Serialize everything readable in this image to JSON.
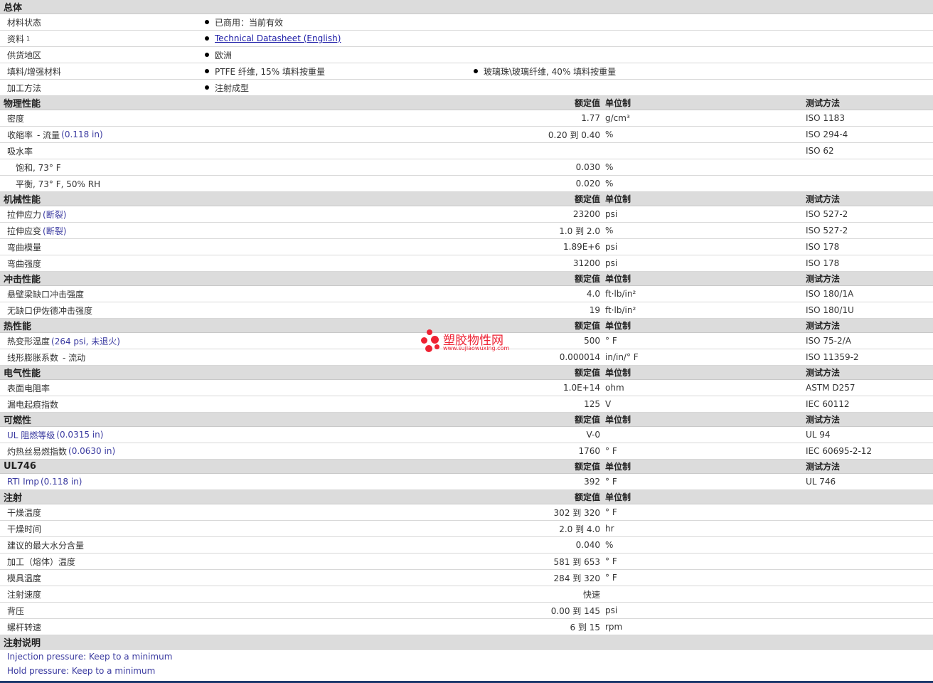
{
  "sections": [
    {
      "title": "总体",
      "kind": "general",
      "rows": [
        {
          "label": "材料状态",
          "values": [
            "已商用：当前有效"
          ]
        },
        {
          "label": "资料",
          "sup": "1",
          "values": [
            "Technical Datasheet (English)"
          ],
          "link": true
        },
        {
          "label": "供货地区",
          "values": [
            "欧洲"
          ]
        },
        {
          "label": "填料/增强材料",
          "values": [
            "PTFE 纤维, 15% 填料按重量",
            "玻璃珠\\玻璃纤维, 40% 填料按重量"
          ]
        },
        {
          "label": "加工方法",
          "values": [
            "注射成型"
          ]
        }
      ]
    },
    {
      "title": "物理性能",
      "col_value": "额定值",
      "col_unit": "单位制",
      "col_method": "测试方法",
      "rows": [
        {
          "label": "密度",
          "value": "1.77",
          "unit": "g/cm³",
          "method": "ISO 1183"
        },
        {
          "label": "收缩率",
          "suffix": "- 流量",
          "cond": "(0.118 in)",
          "value": "0.20 到 0.40",
          "unit": "%",
          "method": "ISO 294-4"
        },
        {
          "label": "吸水率",
          "value": "",
          "unit": "",
          "method": "ISO 62"
        },
        {
          "label": "饱和, 73° F",
          "sub": true,
          "value": "0.030",
          "unit": "%",
          "method": ""
        },
        {
          "label": "平衡, 73° F, 50% RH",
          "sub": true,
          "value": "0.020",
          "unit": "%",
          "method": ""
        }
      ]
    },
    {
      "title": "机械性能",
      "col_value": "额定值",
      "col_unit": "单位制",
      "col_method": "测试方法",
      "rows": [
        {
          "label": "拉伸应力",
          "cond": "(断裂)",
          "value": "23200",
          "unit": "psi",
          "method": "ISO 527-2"
        },
        {
          "label": "拉伸应变",
          "cond": "(断裂)",
          "value": "1.0 到 2.0",
          "unit": "%",
          "method": "ISO 527-2"
        },
        {
          "label": "弯曲模量",
          "value": "1.89E+6",
          "unit": "psi",
          "method": "ISO 178"
        },
        {
          "label": "弯曲强度",
          "value": "31200",
          "unit": "psi",
          "method": "ISO 178"
        }
      ]
    },
    {
      "title": "冲击性能",
      "col_value": "额定值",
      "col_unit": "单位制",
      "col_method": "测试方法",
      "rows": [
        {
          "label": "悬壁梁缺口冲击强度",
          "value": "4.0",
          "unit": "ft·lb/in²",
          "method": "ISO 180/1A"
        },
        {
          "label": "无缺口伊佐德冲击强度",
          "value": "19",
          "unit": "ft·lb/in²",
          "method": "ISO 180/1U"
        }
      ]
    },
    {
      "title": "热性能",
      "col_value": "额定值",
      "col_unit": "单位制",
      "col_method": "测试方法",
      "rows": [
        {
          "label": "热变形温度",
          "cond": "(264 psi, 未退火)",
          "value": "500",
          "unit": "° F",
          "method": "ISO 75-2/A"
        },
        {
          "label": "线形膨胀系数",
          "suffix": "- 流动",
          "value": "0.000014",
          "unit": "in/in/° F",
          "method": "ISO 11359-2"
        }
      ]
    },
    {
      "title": "电气性能",
      "col_value": "额定值",
      "col_unit": "单位制",
      "col_method": "测试方法",
      "rows": [
        {
          "label": "表面电阻率",
          "value": "1.0E+14",
          "unit": "ohm",
          "method": "ASTM D257"
        },
        {
          "label": "漏电起痕指数",
          "value": "125",
          "unit": "V",
          "method": "IEC 60112"
        }
      ]
    },
    {
      "title": "可燃性",
      "col_value": "额定值",
      "col_unit": "单位制",
      "col_method": "测试方法",
      "rows": [
        {
          "label": "UL 阻燃等级",
          "blue_label": true,
          "cond": "(0.0315 in)",
          "value": "V-0",
          "unit": "",
          "method": "UL 94"
        },
        {
          "label": "灼热丝易燃指数",
          "cond": "(0.0630 in)",
          "value": "1760",
          "unit": "° F",
          "method": "IEC 60695-2-12"
        }
      ]
    },
    {
      "title": "UL746",
      "col_value": "额定值",
      "col_unit": "单位制",
      "col_method": "测试方法",
      "rows": [
        {
          "label": "RTI Imp",
          "blue_label": true,
          "cond": "(0.118 in)",
          "value": "392",
          "unit": "° F",
          "method": "UL 746"
        }
      ]
    },
    {
      "title": "注射",
      "col_value": "额定值",
      "col_unit": "单位制",
      "col_method": "",
      "rows": [
        {
          "label": "干燥温度",
          "value": "302 到 320",
          "unit": "° F",
          "method": ""
        },
        {
          "label": "干燥时间",
          "value": "2.0 到 4.0",
          "unit": "hr",
          "method": ""
        },
        {
          "label": "建议的最大水分含量",
          "value": "0.040",
          "unit": "%",
          "method": ""
        },
        {
          "label": "加工（熔体）温度",
          "value": "581 到 653",
          "unit": "° F",
          "method": ""
        },
        {
          "label": "模具温度",
          "value": "284 到 320",
          "unit": "° F",
          "method": ""
        },
        {
          "label": "注射速度",
          "value": "快速",
          "unit": "",
          "method": ""
        },
        {
          "label": "背压",
          "value": "0.00 到 145",
          "unit": "psi",
          "method": ""
        },
        {
          "label": "螺杆转速",
          "value": "6 到 15",
          "unit": "rpm",
          "method": ""
        }
      ]
    },
    {
      "title": "注射说明",
      "kind": "notes",
      "rows": [
        {
          "text": "Injection pressure: Keep to a minimum"
        },
        {
          "text": "Hold pressure: Keep to a minimum"
        }
      ]
    }
  ],
  "watermark": {
    "name": "塑胶物性网",
    "url": "www.sujiaowuxing.com",
    "color": "#ee2233"
  }
}
